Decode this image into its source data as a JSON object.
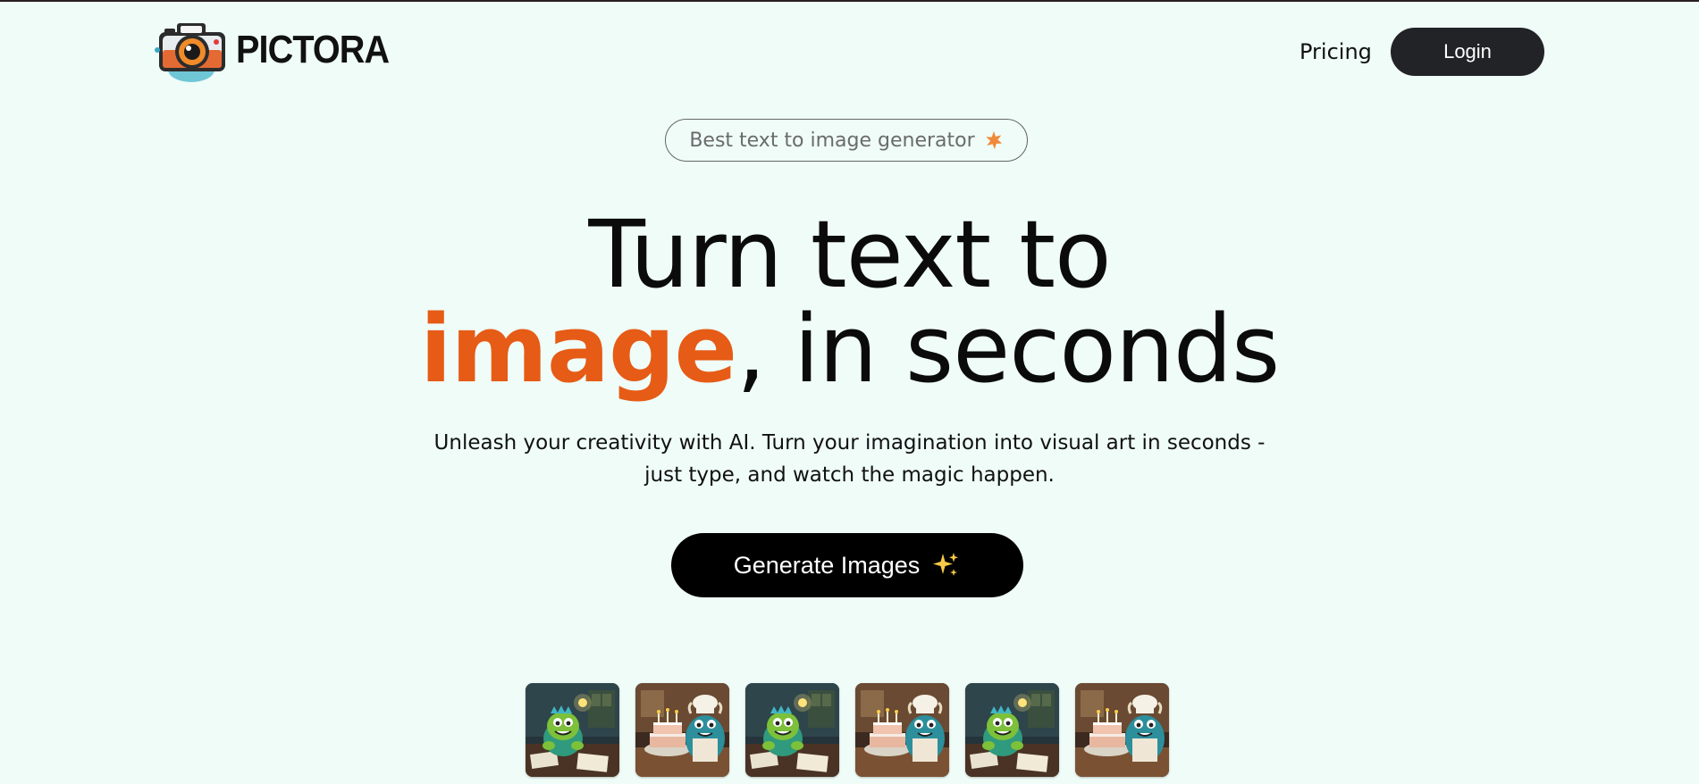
{
  "brand": {
    "name": "PICTORA",
    "logo_icon": "camera-logo-icon",
    "accent_color": "#e65b16"
  },
  "nav": {
    "pricing_label": "Pricing",
    "login_label": "Login"
  },
  "badge": {
    "text": "Best text to image generator",
    "icon": "starburst-icon"
  },
  "hero": {
    "headline_line1": "Turn text to",
    "headline_accent": "image",
    "headline_rest": ", in seconds",
    "subtitle_line1": "Unleash your creativity with AI. Turn your imagination into visual art in seconds -",
    "subtitle_line2": "just type, and watch the magic happen.",
    "cta_label": "Generate Images",
    "cta_icon": "sparkles-icon"
  },
  "gallery": {
    "items": [
      {
        "subject": "green monster at desk with lightbulb"
      },
      {
        "subject": "blue monster chef with birthday cake"
      },
      {
        "subject": "green monster at desk with lightbulb"
      },
      {
        "subject": "blue monster chef with birthday cake"
      },
      {
        "subject": "green monster at desk with lightbulb"
      },
      {
        "subject": "blue monster chef with birthday cake"
      }
    ]
  }
}
